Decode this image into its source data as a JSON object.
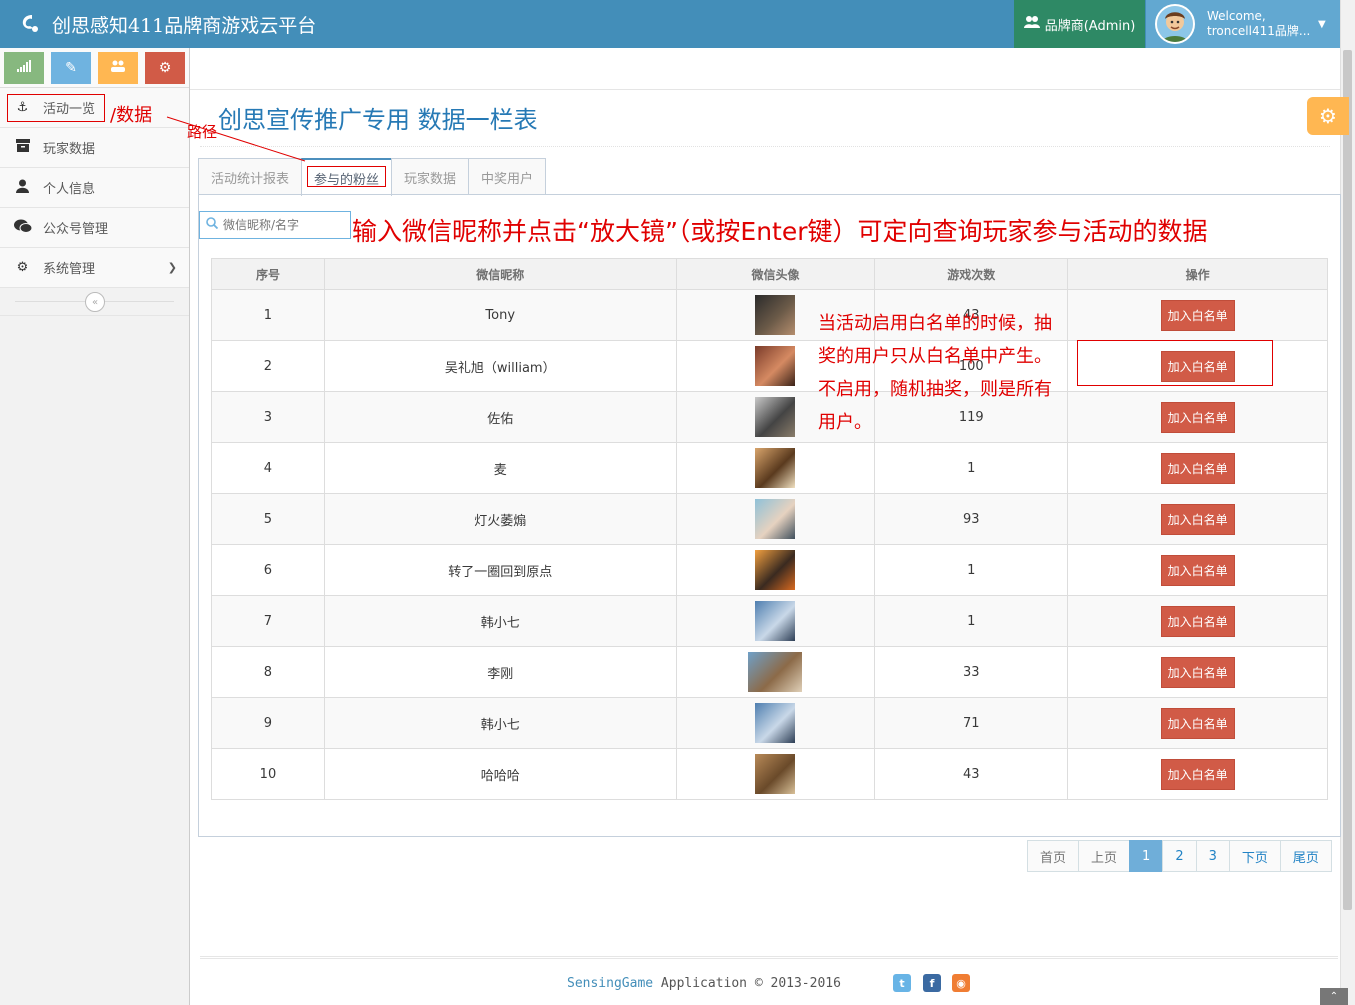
{
  "header": {
    "brand": "创思感知411品牌商游戏云平台",
    "role_label": "品牌商(Admin)",
    "welcome": "Welcome,",
    "user_name": "troncell411品牌..."
  },
  "sidebar": {
    "shortcut_colors": [
      "#87b87f",
      "#6fb3e0",
      "#ffb752",
      "#d15b47"
    ],
    "items": [
      {
        "label": "活动一览",
        "icon": "anchor-icon"
      },
      {
        "label": "玩家数据",
        "icon": "archive-icon"
      },
      {
        "label": "个人信息",
        "icon": "user-icon"
      },
      {
        "label": "公众号管理",
        "icon": "wechat-icon"
      },
      {
        "label": "系统管理",
        "icon": "gear-icon"
      }
    ]
  },
  "page": {
    "title": "创思宣传推广专用 数据一栏表"
  },
  "tabs": [
    "活动统计报表",
    "参与的粉丝",
    "玩家数据",
    "中奖用户"
  ],
  "search": {
    "placeholder": "微信昵称/名字"
  },
  "table": {
    "headers": [
      "序号",
      "微信昵称",
      "微信头像",
      "游戏次数",
      "操作"
    ],
    "action_label": "加入白名单",
    "rows": [
      {
        "no": "1",
        "nickname": "Tony",
        "count": "43"
      },
      {
        "no": "2",
        "nickname": "吴礼旭（william）",
        "count": "100"
      },
      {
        "no": "3",
        "nickname": "佐佑",
        "count": "119"
      },
      {
        "no": "4",
        "nickname": "麦",
        "count": "1"
      },
      {
        "no": "5",
        "nickname": "灯火萎煽",
        "count": "93"
      },
      {
        "no": "6",
        "nickname": "转了一圈回到原点",
        "count": "1"
      },
      {
        "no": "7",
        "nickname": "韩小七",
        "count": "1"
      },
      {
        "no": "8",
        "nickname": "李刚",
        "count": "33"
      },
      {
        "no": "9",
        "nickname": "韩小七",
        "count": "71"
      },
      {
        "no": "10",
        "nickname": "哈哈哈",
        "count": "43"
      }
    ]
  },
  "pager": {
    "first": "首页",
    "prev": "上页",
    "pages": [
      "1",
      "2",
      "3"
    ],
    "next": "下页",
    "last": "尾页"
  },
  "footer": {
    "brand": "SensingGame",
    "rest": " Application © 2013-2016"
  },
  "annotations": {
    "data_path": "/数据",
    "path_label": "路径",
    "search_hint": "输入微信昵称并点击“放大镜”（或按Enter键）可定向查询玩家参与活动的数据",
    "whitelist_note": [
      "当活动启用白名单的时候，抽",
      "奖的用户只从白名单中产生。",
      "不启用，随机抽奖，则是所有",
      "用户。"
    ]
  }
}
